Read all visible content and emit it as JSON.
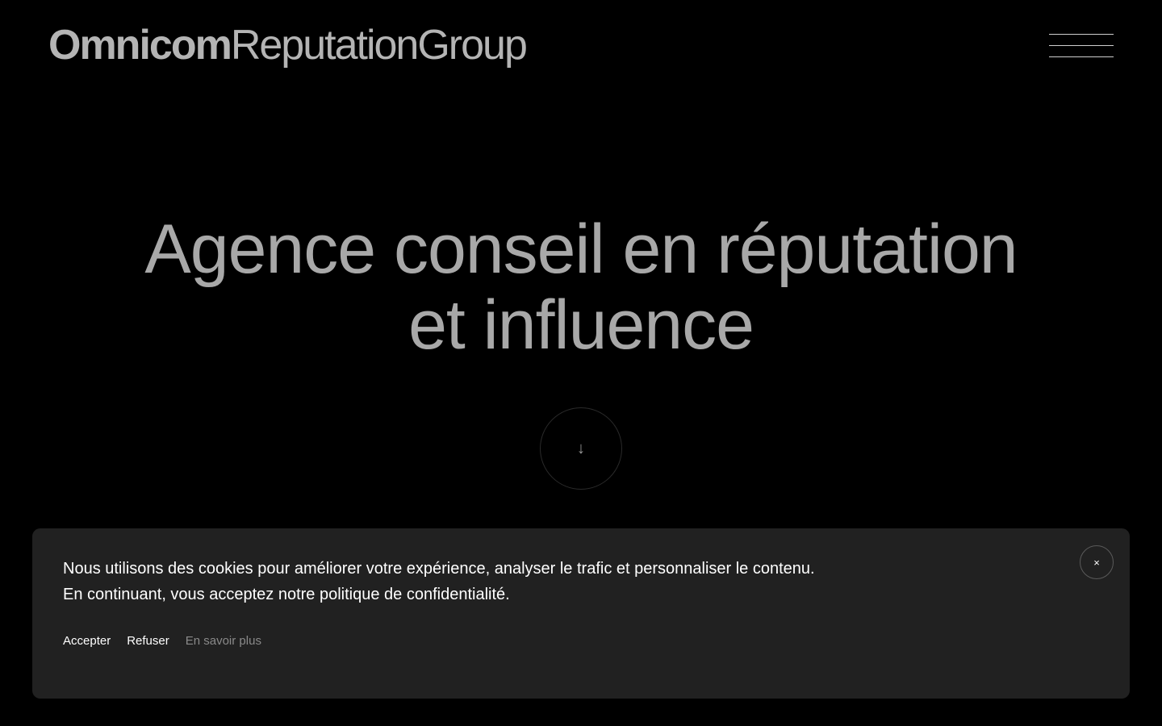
{
  "header": {
    "logo_bold": "Omnicom",
    "logo_light": "ReputationGroup",
    "menu_icon": "hamburger-icon"
  },
  "hero": {
    "title_line1": "Agence conseil en réputation",
    "title_line2": "et influence",
    "scroll_icon": "arrow-down-icon",
    "scroll_glyph": "↓"
  },
  "cookie_banner": {
    "text_line1": "Nous utilisons des cookies pour améliorer votre expérience, analyser le trafic et personnaliser le contenu.",
    "text_line2": "En continuant, vous acceptez notre politique de confidentialité.",
    "accept_label": "Accepter",
    "refuse_label": "Refuser",
    "learn_more_label": "En savoir plus",
    "close_icon": "close-icon",
    "close_glyph": "×"
  },
  "colors": {
    "background": "#000000",
    "banner_background": "#212121",
    "hero_text": "#a8a8a8",
    "logo_text": "#b4b4b4",
    "muted_link": "#8a8a8a"
  }
}
